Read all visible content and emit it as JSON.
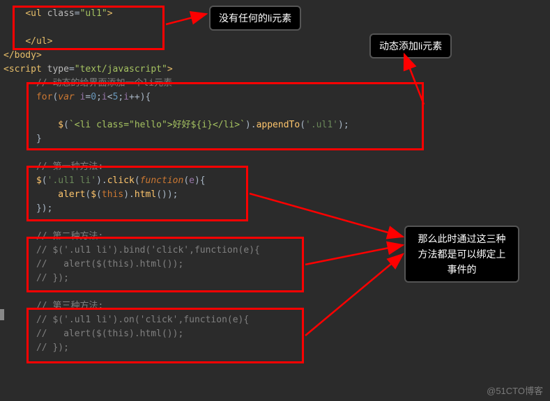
{
  "code": {
    "l1_open": "    <ul class=\"ul1\">",
    "l2_blank": "",
    "l3_close": "    </ul>",
    "l4_body": "</body>",
    "l5_script": "<script type=\"text/javascript\">",
    "l6_comment": "      // 动态的给界面添加一个li元素",
    "l7_for": "      for(var i=0;i<5;i++){",
    "l8_blank": "",
    "l9_append": "          $(`<li class=\"hello\">好好${i}</li>`).appendTo('.ul1');",
    "l10_brace": "      }",
    "l11_blank": "",
    "l12_c1": "      // 第一种方法:",
    "l13_m1a": "      $('.ul1 li').click(function(e){",
    "l14_m1b": "          alert($(this).html());",
    "l15_m1c": "      });",
    "l16_blank": "",
    "l17_c2": "      // 第二种方法:",
    "l18_m2a": "      // $('.ul1 li').bind('click',function(e){",
    "l19_m2b": "      //   alert($(this).html());",
    "l20_m2c": "      // });",
    "l21_blank": "",
    "l22_c3": "      // 第三种方法:",
    "l23_m3a": "      // $('.ul1 li').on('click',function(e){",
    "l24_m3b": "      //   alert($(this).html());",
    "l25_m3c": "      // });"
  },
  "callouts": {
    "c1": "没有任何的li元素",
    "c2": "动态添加li元素",
    "c3": "那么此时通过这三种方法都是可以绑定上事件的"
  },
  "watermark": "@51CTO博客"
}
